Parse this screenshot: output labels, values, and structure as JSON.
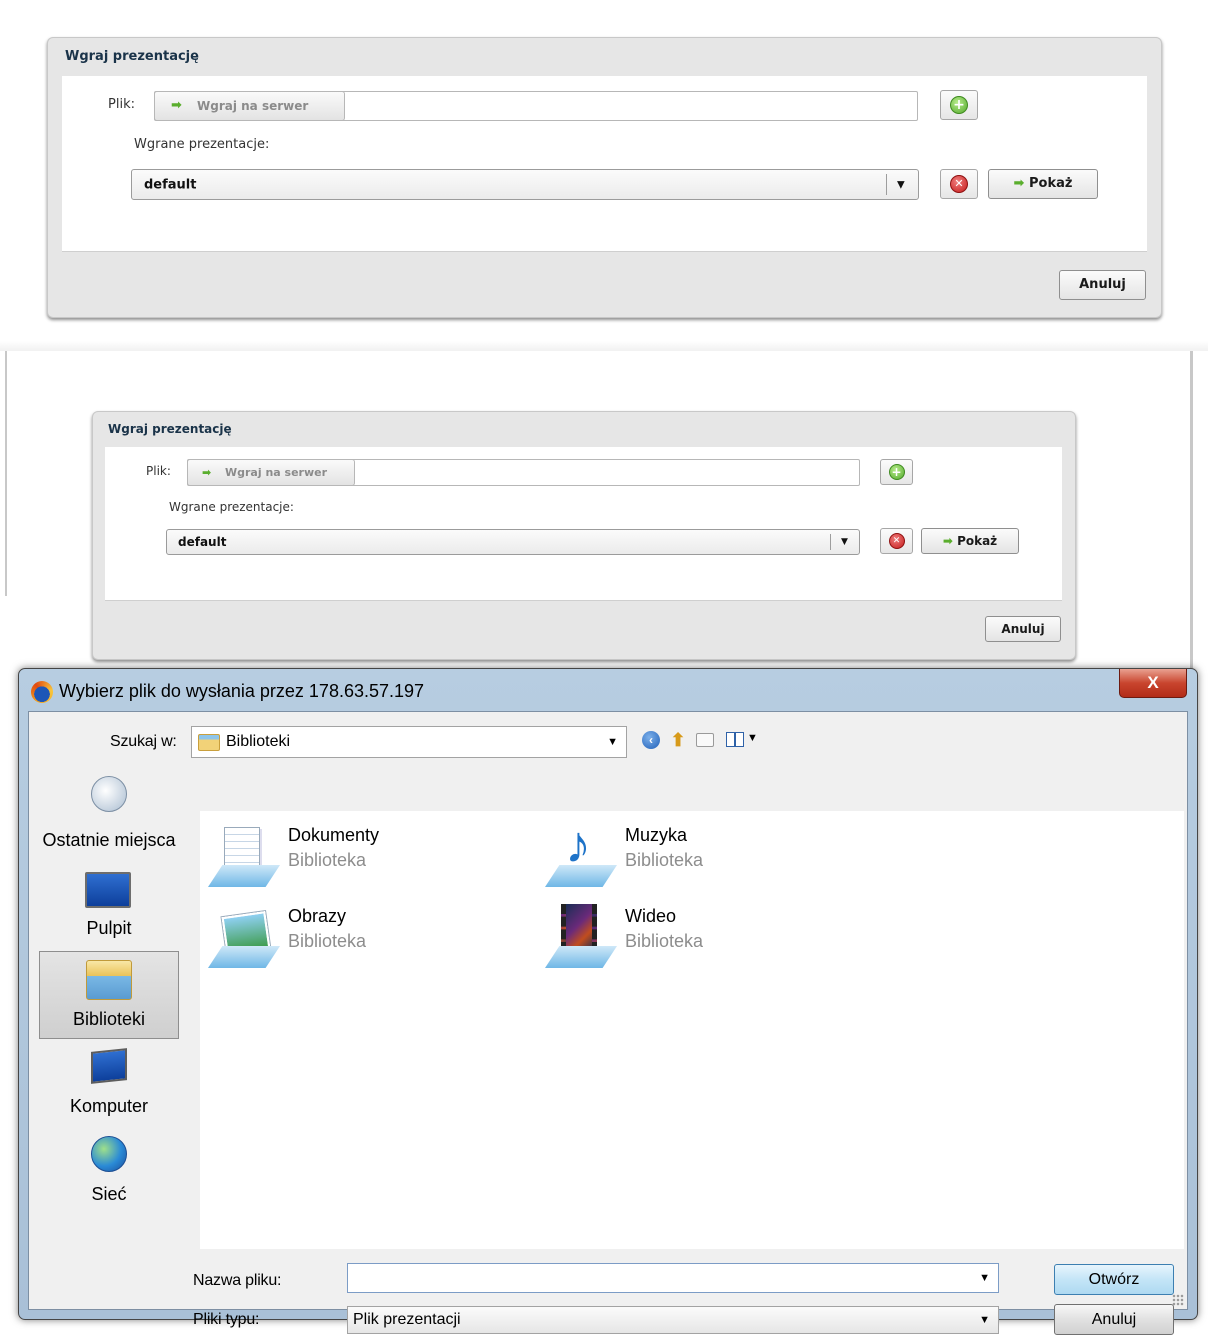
{
  "panel_top": {
    "title": "Wgraj prezentację",
    "file_label": "Plik:",
    "upload_button": "Wgraj na serwer",
    "uploaded_label": "Wgrane prezentacje:",
    "selected_presentation": "default",
    "show_button": "Pokaż",
    "cancel_button": "Anuluj"
  },
  "panel_bottom": {
    "title": "Wgraj prezentację",
    "file_label": "Plik:",
    "upload_button": "Wgraj na serwer",
    "uploaded_label": "Wgrane prezentacje:",
    "selected_presentation": "default",
    "show_button": "Pokaż",
    "cancel_button": "Anuluj"
  },
  "file_dialog": {
    "title": "Wybierz plik do wysłania przez 178.63.57.197",
    "close_symbol": "X",
    "look_in_label": "Szukaj w:",
    "look_in_value": "Biblioteki",
    "places": [
      {
        "label": "Ostatnie miejsca",
        "icon": "recent-places-icon"
      },
      {
        "label": "Pulpit",
        "icon": "desktop-icon"
      },
      {
        "label": "Biblioteki",
        "icon": "libraries-icon",
        "selected": true
      },
      {
        "label": "Komputer",
        "icon": "computer-icon"
      },
      {
        "label": "Sieć",
        "icon": "network-icon"
      }
    ],
    "libraries": [
      {
        "name": "Dokumenty",
        "type": "Biblioteka",
        "icon": "documents-library-icon"
      },
      {
        "name": "Muzyka",
        "type": "Biblioteka",
        "icon": "music-library-icon"
      },
      {
        "name": "Obrazy",
        "type": "Biblioteka",
        "icon": "pictures-library-icon"
      },
      {
        "name": "Wideo",
        "type": "Biblioteka",
        "icon": "video-library-icon"
      }
    ],
    "filename_label": "Nazwa pliku:",
    "filename_value": "",
    "filetype_label": "Pliki typu:",
    "filetype_value": "Plik prezentacji",
    "open_button": "Otwórz",
    "cancel_button": "Anuluj"
  }
}
